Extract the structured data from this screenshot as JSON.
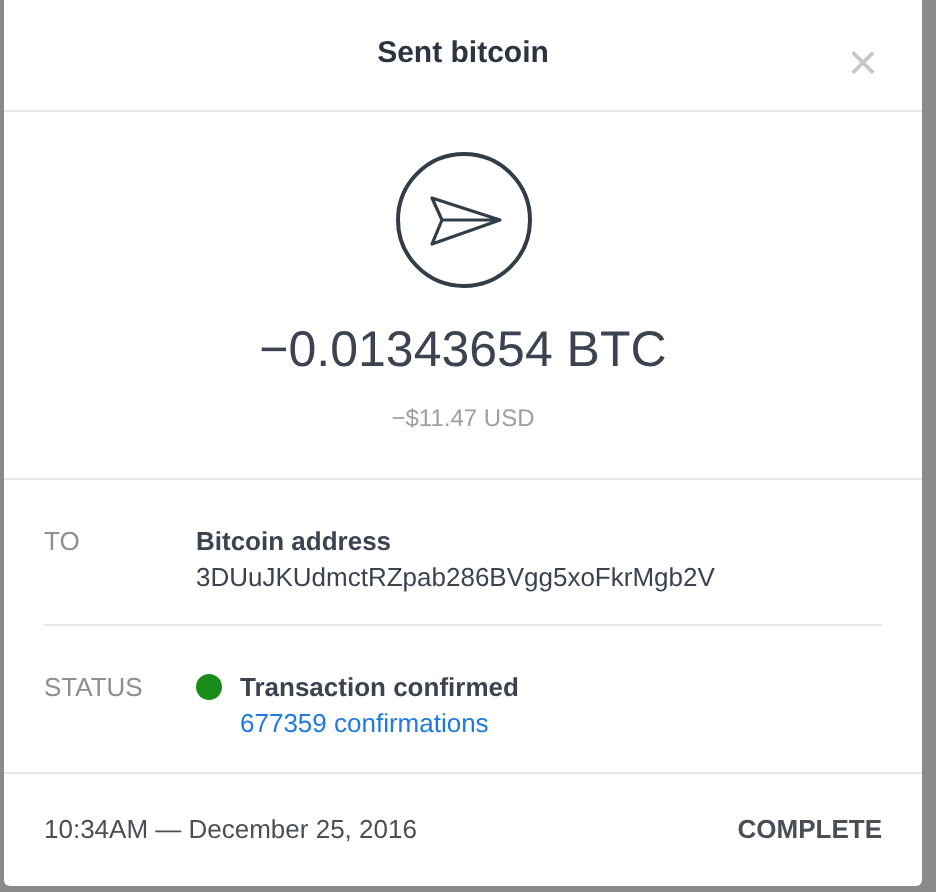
{
  "dialog": {
    "title": "Sent bitcoin",
    "close": "×"
  },
  "amount": {
    "crypto": "−0.01343654 BTC",
    "fiat": "−$11.47 USD"
  },
  "details": [
    {
      "label": "TO",
      "title": "Bitcoin address",
      "detail": "3DUuJKUdmctRZpab286BVgg5xoFkrMgb2V"
    },
    {
      "label": "STATUS",
      "title": "Transaction confirmed",
      "detail": "677359 confirmations",
      "color": "#1a8c1a"
    }
  ],
  "footer": {
    "timestamp": "10:34AM — December 25, 2016",
    "state": "COMPLETE"
  }
}
